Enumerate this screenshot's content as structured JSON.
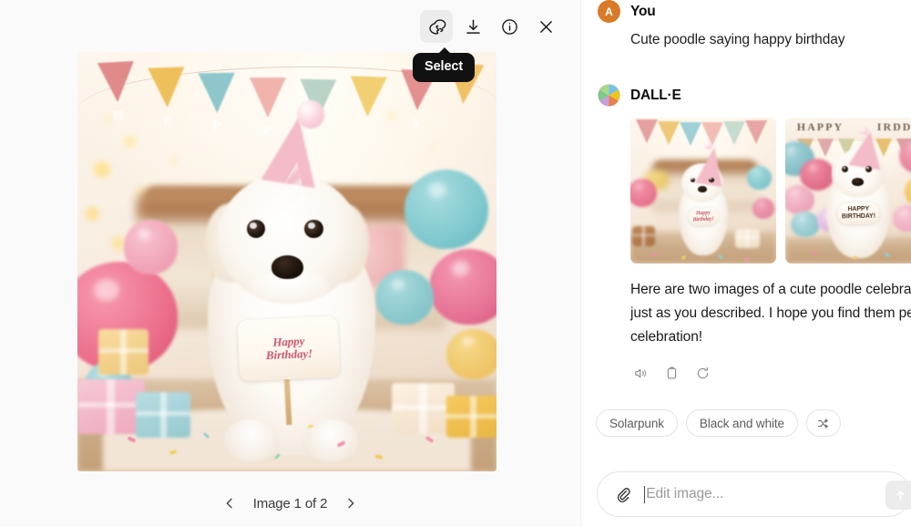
{
  "viewer": {
    "toolbar": [
      {
        "name": "select-tool",
        "label": "Select",
        "active": true
      },
      {
        "name": "download-tool",
        "label": "Download",
        "active": false
      },
      {
        "name": "info-tool",
        "label": "Info",
        "active": false
      },
      {
        "name": "close-tool",
        "label": "Close",
        "active": false
      }
    ],
    "tooltip": "Select",
    "image_counter": "Image 1 of 2",
    "prev_label": "Previous image",
    "next_label": "Next image",
    "main_image": {
      "alt": "Cute white poodle wearing a pink party hat holding a Happy Birthday sign",
      "bunting_letters": [
        "H",
        "E",
        "P",
        "P",
        "Y",
        "I",
        "D",
        "D",
        "A"
      ],
      "sign_line1": "Happy",
      "sign_line2": "Birthday!"
    }
  },
  "chat": {
    "user": {
      "avatar_initial": "A",
      "avatar_color": "#d97a28",
      "author": "You",
      "text": "Cute poodle saying happy birthday"
    },
    "assistant": {
      "author": "DALL·E",
      "text": "Here are two images of a cute poodle celebrating a birthday, just as you described. I hope you find them perfect for your celebration!",
      "thumbnails": [
        {
          "name": "thumbnail-image-1",
          "alt": "Poodle with birthday sign in a decorated room",
          "sign": "Happy Birthday!"
        },
        {
          "name": "thumbnail-image-2",
          "alt": "Poodle with HAPPY BIRTHDAY sign surrounded by balloons",
          "sign": "HAPPY BIRTHDAY!"
        }
      ],
      "actions": [
        {
          "name": "read-aloud-button",
          "label": "Read aloud"
        },
        {
          "name": "copy-button",
          "label": "Copy"
        },
        {
          "name": "regenerate-button",
          "label": "Regenerate"
        }
      ]
    },
    "chips": [
      {
        "name": "chip-solarpunk",
        "label": "Solarpunk",
        "icon": false
      },
      {
        "name": "chip-black-and-white",
        "label": "Black and white",
        "icon": false
      },
      {
        "name": "chip-shuffle",
        "label": "",
        "icon": true
      }
    ],
    "composer": {
      "placeholder": "Edit image...",
      "value": "",
      "attach_label": "Attach file",
      "send_label": "Send"
    }
  }
}
